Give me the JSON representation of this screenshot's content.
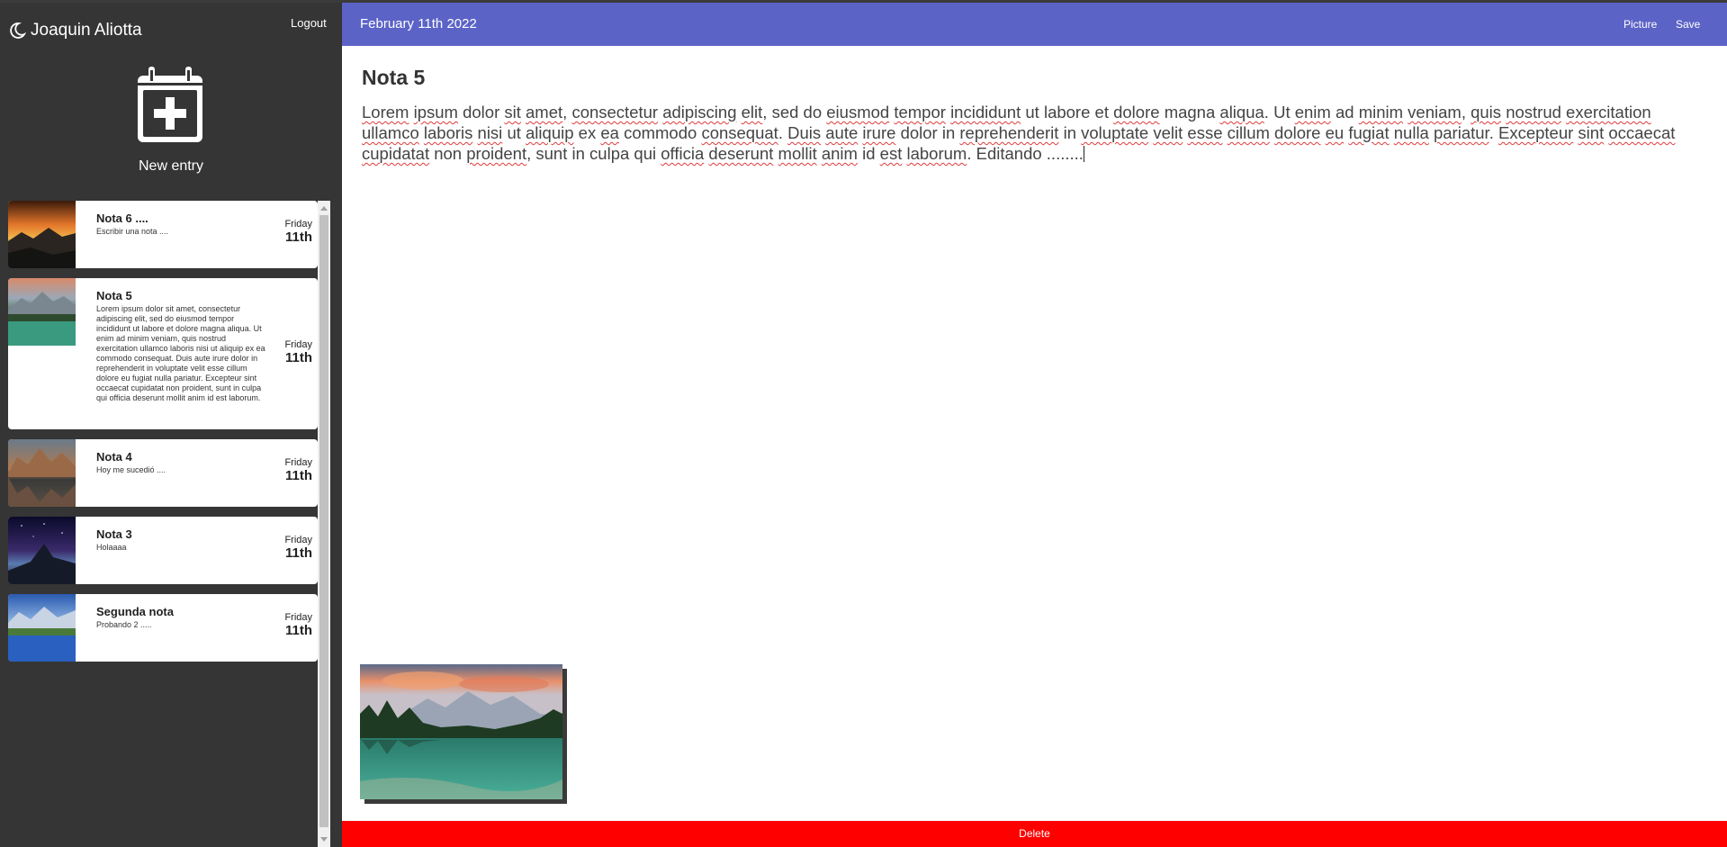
{
  "user": {
    "name": "Joaquin Aliotta",
    "logout_label": "Logout"
  },
  "new_entry": {
    "label": "New entry"
  },
  "entries": [
    {
      "title": "Nota 6 ....",
      "snippet": "Escribir una nota ....",
      "day_name": "Friday",
      "day_num": "11th",
      "thumb": "sunset-mountains"
    },
    {
      "title": "Nota 5",
      "snippet": "Lorem ipsum dolor sit amet, consectetur adipiscing elit, sed do eiusmod tempor incididunt ut labore et dolore magna aliqua. Ut enim ad minim veniam, quis nostrud exercitation ullamco laboris nisi ut aliquip ex ea commodo consequat. Duis aute irure dolor in reprehenderit in voluptate velit esse cillum dolore eu fugiat nulla pariatur. Excepteur sint occaecat cupidatat non proident, sunt in culpa qui officia deserunt mollit anim id est laborum.",
      "day_name": "Friday",
      "day_num": "11th",
      "thumb": "lake-mountains"
    },
    {
      "title": "Nota 4",
      "snippet": "Hoy me sucedió ....",
      "day_name": "Friday",
      "day_num": "11th",
      "thumb": "rock-reflection"
    },
    {
      "title": "Nota 3",
      "snippet": "Holaaaa",
      "day_name": "Friday",
      "day_num": "11th",
      "thumb": "night-sky"
    },
    {
      "title": "Segunda nota",
      "snippet": "Probando 2 .....",
      "day_name": "Friday",
      "day_num": "11th",
      "thumb": "blue-lake"
    }
  ],
  "header": {
    "date": "February 11th 2022",
    "picture_label": "Picture",
    "save_label": "Save"
  },
  "note": {
    "title": "Nota 5",
    "body": "Lorem ipsum dolor sit amet, consectetur adipiscing elit, sed do eiusmod tempor incididunt ut labore et dolore magna aliqua. Ut enim ad minim veniam, quis nostrud exercitation ullamco laboris nisi ut aliquip ex ea commodo consequat. Duis aute irure dolor in reprehenderit in voluptate velit esse cillum dolore eu fugiat nulla pariatur. Excepteur sint occaecat cupidatat non proident, sunt in culpa qui officia deserunt mollit anim id est laborum. Editando ........"
  },
  "delete_label": "Delete",
  "colors": {
    "sidebar": "#353535",
    "header": "#5c63c6",
    "delete": "#ff0000"
  }
}
